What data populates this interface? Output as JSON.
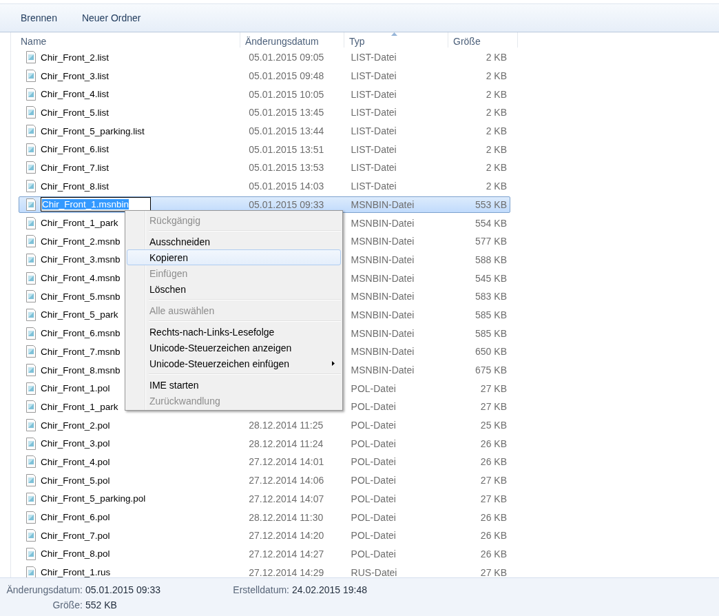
{
  "toolbar": {
    "buttons": [
      "Brennen",
      "Neuer Ordner"
    ]
  },
  "columns": [
    {
      "label": "Name",
      "sorted": false
    },
    {
      "label": "Änderungsdatum",
      "sorted": false
    },
    {
      "label": "Typ",
      "sorted": true
    },
    {
      "label": "Größe",
      "sorted": false
    }
  ],
  "rows": [
    {
      "name": "Chir_Front_2.list",
      "date": "05.01.2015 09:05",
      "type": "LIST-Datei",
      "size": "2 KB",
      "selected": false
    },
    {
      "name": "Chir_Front_3.list",
      "date": "05.01.2015 09:48",
      "type": "LIST-Datei",
      "size": "2 KB",
      "selected": false
    },
    {
      "name": "Chir_Front_4.list",
      "date": "05.01.2015 10:05",
      "type": "LIST-Datei",
      "size": "2 KB",
      "selected": false
    },
    {
      "name": "Chir_Front_5.list",
      "date": "05.01.2015 13:45",
      "type": "LIST-Datei",
      "size": "2 KB",
      "selected": false
    },
    {
      "name": "Chir_Front_5_parking.list",
      "date": "05.01.2015 13:44",
      "type": "LIST-Datei",
      "size": "2 KB",
      "selected": false
    },
    {
      "name": "Chir_Front_6.list",
      "date": "05.01.2015 13:51",
      "type": "LIST-Datei",
      "size": "2 KB",
      "selected": false
    },
    {
      "name": "Chir_Front_7.list",
      "date": "05.01.2015 13:53",
      "type": "LIST-Datei",
      "size": "2 KB",
      "selected": false
    },
    {
      "name": "Chir_Front_8.list",
      "date": "05.01.2015 14:03",
      "type": "LIST-Datei",
      "size": "2 KB",
      "selected": false
    },
    {
      "name": "Chir_Front_1.msnbin",
      "date": "05.01.2015 09:33",
      "type": "MSNBIN-Datei",
      "size": "553 KB",
      "selected": true,
      "editing": true
    },
    {
      "name": "Chir_Front_1_park",
      "type": "MSNBIN-Datei",
      "size": "554 KB",
      "selected": false
    },
    {
      "name": "Chir_Front_2.msnb",
      "type": "MSNBIN-Datei",
      "size": "577 KB",
      "selected": false
    },
    {
      "name": "Chir_Front_3.msnb",
      "type": "MSNBIN-Datei",
      "size": "588 KB",
      "selected": false
    },
    {
      "name": "Chir_Front_4.msnb",
      "type": "MSNBIN-Datei",
      "size": "545 KB",
      "selected": false
    },
    {
      "name": "Chir_Front_5.msnb",
      "type": "MSNBIN-Datei",
      "size": "583 KB",
      "selected": false
    },
    {
      "name": "Chir_Front_5_park",
      "type": "MSNBIN-Datei",
      "size": "585 KB",
      "selected": false
    },
    {
      "name": "Chir_Front_6.msnb",
      "type": "MSNBIN-Datei",
      "size": "585 KB",
      "selected": false
    },
    {
      "name": "Chir_Front_7.msnb",
      "type": "MSNBIN-Datei",
      "size": "650 KB",
      "selected": false
    },
    {
      "name": "Chir_Front_8.msnb",
      "type": "MSNBIN-Datei",
      "size": "675 KB",
      "selected": false
    },
    {
      "name": "Chir_Front_1.pol",
      "type": "POL-Datei",
      "size": "27 KB",
      "selected": false
    },
    {
      "name": "Chir_Front_1_park",
      "type": "POL-Datei",
      "size": "27 KB",
      "selected": false
    },
    {
      "name": "Chir_Front_2.pol",
      "date": "28.12.2014 11:25",
      "type": "POL-Datei",
      "size": "25 KB",
      "selected": false
    },
    {
      "name": "Chir_Front_3.pol",
      "date": "28.12.2014 11:24",
      "type": "POL-Datei",
      "size": "26 KB",
      "selected": false
    },
    {
      "name": "Chir_Front_4.pol",
      "date": "27.12.2014 14:01",
      "type": "POL-Datei",
      "size": "26 KB",
      "selected": false
    },
    {
      "name": "Chir_Front_5.pol",
      "date": "27.12.2014 14:06",
      "type": "POL-Datei",
      "size": "27 KB",
      "selected": false
    },
    {
      "name": "Chir_Front_5_parking.pol",
      "date": "27.12.2014 14:07",
      "type": "POL-Datei",
      "size": "27 KB",
      "selected": false
    },
    {
      "name": "Chir_Front_6.pol",
      "date": "28.12.2014 11:30",
      "type": "POL-Datei",
      "size": "26 KB",
      "selected": false
    },
    {
      "name": "Chir_Front_7.pol",
      "date": "27.12.2014 14:20",
      "type": "POL-Datei",
      "size": "26 KB",
      "selected": false
    },
    {
      "name": "Chir_Front_8.pol",
      "date": "27.12.2014 14:27",
      "type": "POL-Datei",
      "size": "26 KB",
      "selected": false
    },
    {
      "name": "Chir_Front_1.rus",
      "date": "27.12.2014 14:29",
      "type": "RUS-Datei",
      "size": "27 KB",
      "selected": false
    }
  ],
  "context_menu": {
    "items": [
      {
        "kind": "item",
        "label": "Rückgängig",
        "disabled": true,
        "selected": false
      },
      {
        "kind": "separator"
      },
      {
        "kind": "item",
        "label": "Ausschneiden",
        "disabled": false,
        "selected": false
      },
      {
        "kind": "item",
        "label": "Kopieren",
        "disabled": false,
        "selected": true
      },
      {
        "kind": "item",
        "label": "Einfügen",
        "disabled": true,
        "selected": false
      },
      {
        "kind": "item",
        "label": "Löschen",
        "disabled": false,
        "selected": false
      },
      {
        "kind": "separator"
      },
      {
        "kind": "item",
        "label": "Alle auswählen",
        "disabled": true,
        "selected": false
      },
      {
        "kind": "separator"
      },
      {
        "kind": "item",
        "label": "Rechts-nach-Links-Lesefolge",
        "disabled": false,
        "selected": false
      },
      {
        "kind": "item",
        "label": "Unicode-Steuerzeichen anzeigen",
        "disabled": false,
        "selected": false
      },
      {
        "kind": "item",
        "label": "Unicode-Steuerzeichen einfügen",
        "disabled": false,
        "selected": false,
        "submenu": true
      },
      {
        "kind": "separator"
      },
      {
        "kind": "item",
        "label": "IME starten",
        "disabled": false,
        "selected": false
      },
      {
        "kind": "item",
        "label": "Zurückwandlung",
        "disabled": true,
        "selected": false
      }
    ]
  },
  "details": [
    {
      "label": "Änderungsdatum:",
      "value": "05.01.2015 09:33"
    },
    {
      "label": "Erstelldatum:",
      "value": "24.02.2015 19:48"
    },
    {
      "label": "Größe:",
      "value": "552 KB"
    }
  ]
}
